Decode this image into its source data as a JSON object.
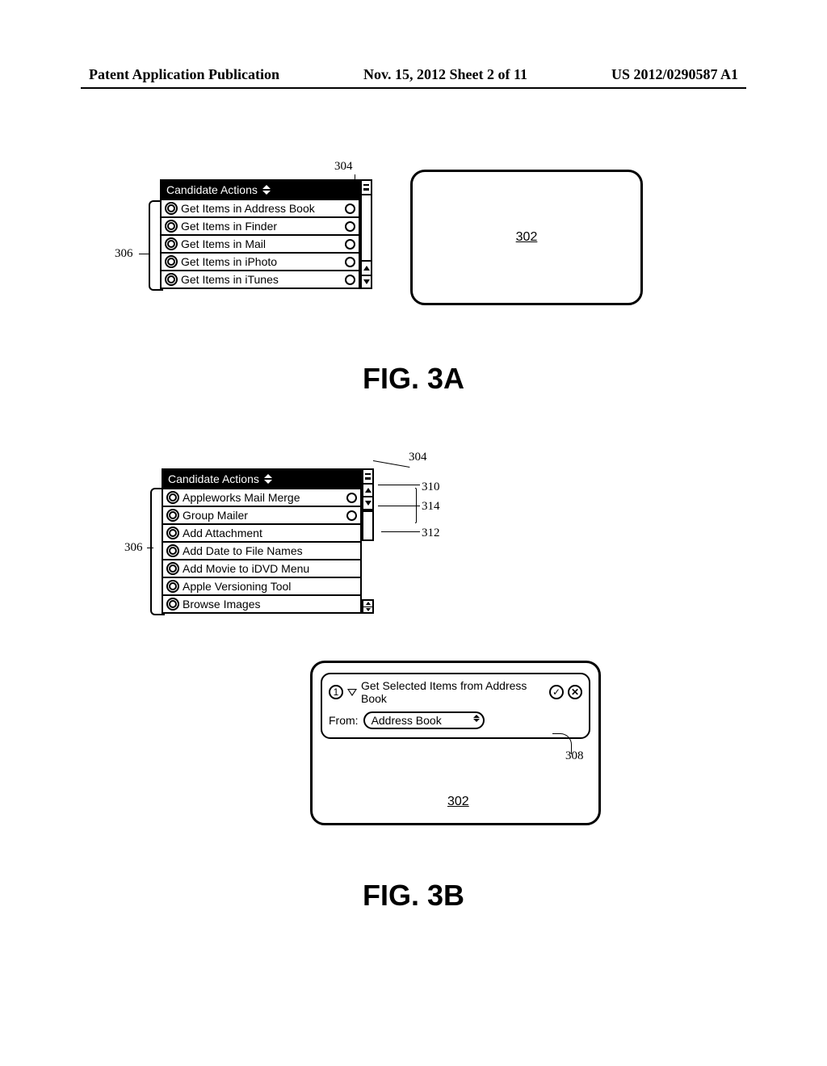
{
  "header": {
    "left": "Patent Application Publication",
    "center": "Nov. 15, 2012  Sheet 2 of 11",
    "right": "US 2012/0290587 A1"
  },
  "fig3a": {
    "label": "FIG. 3A",
    "ref_304": "304",
    "ref_306": "306",
    "pane_title": "Candidate Actions",
    "items": [
      "Get Items in Address Book",
      "Get Items in Finder",
      "Get Items in Mail",
      "Get Items in iPhoto",
      "Get Items in iTunes"
    ],
    "workflow_ref": "302"
  },
  "fig3b": {
    "label": "FIG. 3B",
    "ref_304": "304",
    "ref_306": "306",
    "ref_310": "310",
    "ref_312": "312",
    "ref_314": "314",
    "ref_308": "308",
    "pane_title": "Candidate Actions",
    "items": [
      "Appleworks Mail Merge",
      "Group Mailer",
      "Add Attachment",
      "Add Date to File Names",
      "Add Movie to iDVD Menu",
      "Apple Versioning Tool",
      "Browse Images"
    ],
    "workflow_step_title": "Get Selected Items from Address Book",
    "workflow_step_num": "1",
    "workflow_from_label": "From:",
    "workflow_from_value": "Address Book",
    "workflow_ref": "302"
  }
}
